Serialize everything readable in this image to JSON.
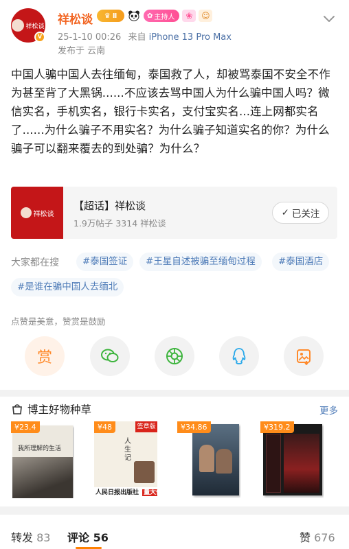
{
  "header": {
    "username": "祥松谈",
    "level_badge": "Ⅱ",
    "host_badge": "主持人",
    "timestamp": "25-1-10 00:26",
    "source_prefix": "来自",
    "device": "iPhone 13 Pro Max",
    "location": "发布于 云南"
  },
  "post": {
    "text": "中国人骗中国人去往缅甸，泰国救了人，却被骂泰国不安全不作为甚至背了大黑锅......不应该去骂中国人为什么骗中国人吗？微信实名，手机实名，银行卡实名，支付宝实名...连上网都实名了......为什么骗子不用实名？为什么骗子知道实名的你？为什么骗子可以翻来覆去的到处骗？为什么？"
  },
  "topic_card": {
    "title": "【超话】祥松谈",
    "stats": "1.9万帖子 3314 祥松谈",
    "follow_label": "已关注"
  },
  "search": {
    "label": "大家都在搜",
    "tags": [
      "#泰国签证",
      "#王星自述被骗至缅甸过程",
      "#泰国酒店",
      "#是谁在骗中国人去缅北"
    ]
  },
  "like_note": "点赞是美意，赞赏是鼓励",
  "share": {
    "reward_label": "赏",
    "items": [
      "reward",
      "wechat",
      "moments",
      "qq",
      "save-image"
    ]
  },
  "recommend": {
    "title": "博主好物种草",
    "more": "更多",
    "books": [
      {
        "price": "¥23.4",
        "cover_text": "我所理解的生活"
      },
      {
        "price": "¥48",
        "cover_text": "人生记",
        "publisher": "人民日报出版社",
        "promo": "量大优惠",
        "edition": "签章版"
      },
      {
        "price": "¥34.86",
        "cover_text": ""
      },
      {
        "price": "¥319.2",
        "cover_text": ""
      }
    ]
  },
  "tabs": {
    "repost_label": "转发",
    "repost_count": "83",
    "comment_label": "评论",
    "comment_count": "56",
    "like_label": "赞",
    "like_count": "676"
  },
  "colors": {
    "username": "#f26522",
    "link": "#4f7cb8",
    "accent": "#ff8200",
    "brand_red": "#c41618"
  }
}
